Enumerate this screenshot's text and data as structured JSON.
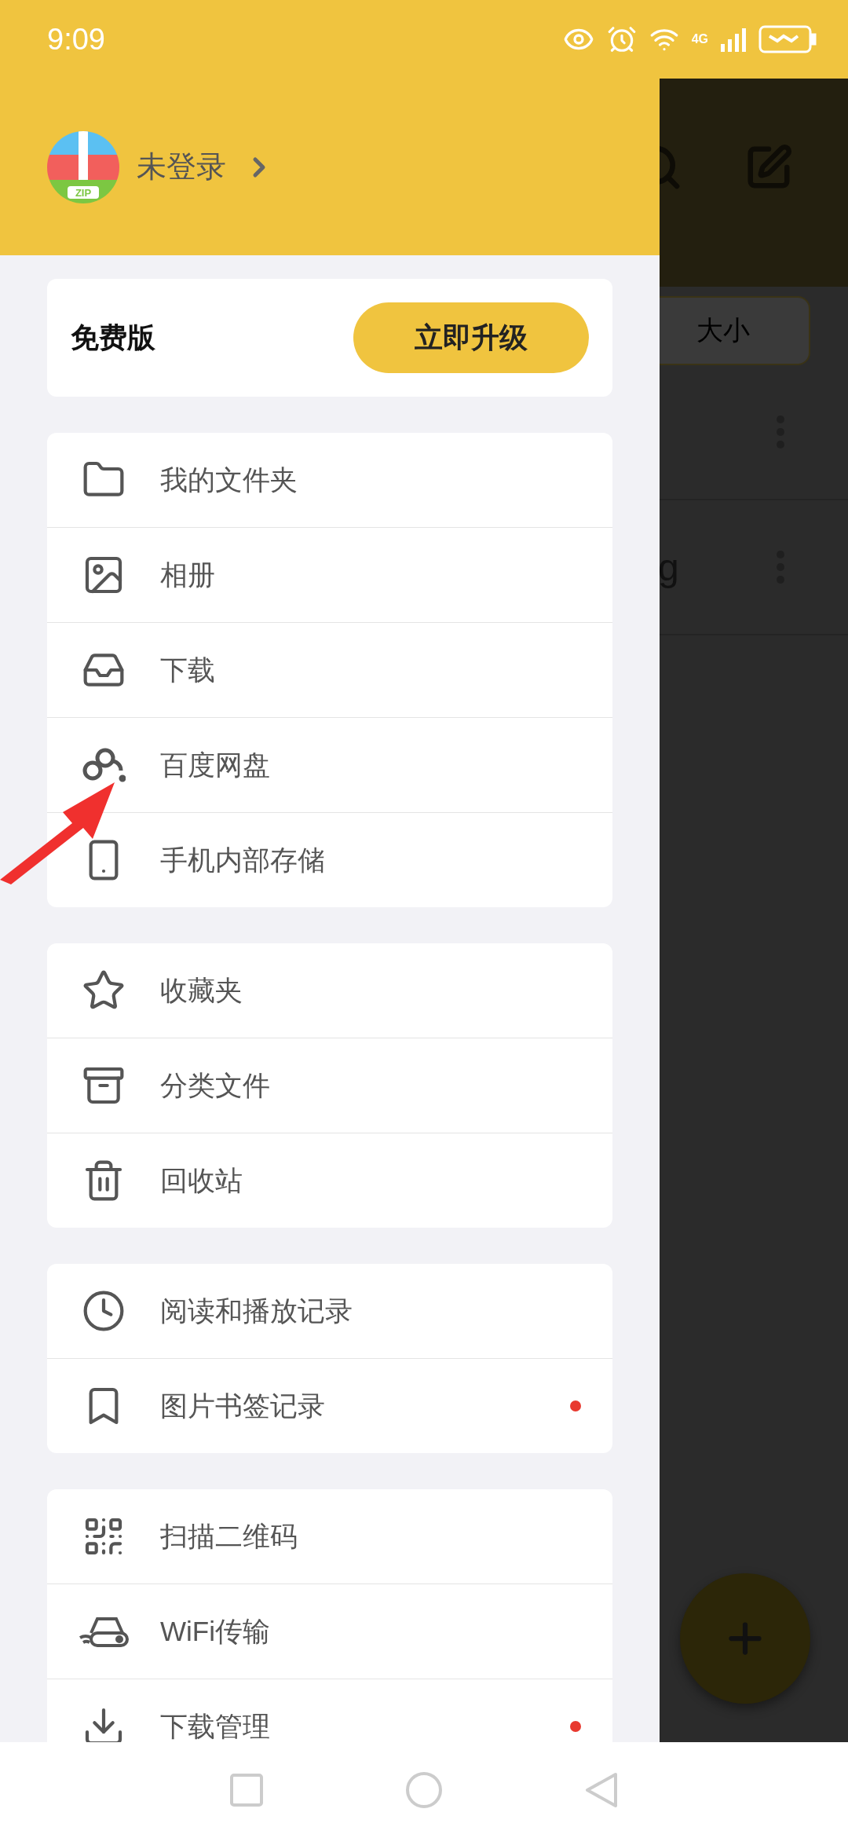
{
  "status_bar": {
    "time": "9:09",
    "network": "4G"
  },
  "profile": {
    "logo_text": "ZIP",
    "name": "未登录"
  },
  "plan": {
    "label": "免费版",
    "upgrade_button": "立即升级"
  },
  "menu_groups": [
    {
      "items": [
        {
          "label": "我的文件夹",
          "dot": false
        },
        {
          "label": "相册",
          "dot": false
        },
        {
          "label": "下载",
          "dot": false
        },
        {
          "label": "百度网盘",
          "dot": false
        },
        {
          "label": "手机内部存储",
          "dot": false
        }
      ]
    },
    {
      "items": [
        {
          "label": "收藏夹",
          "dot": false
        },
        {
          "label": "分类文件",
          "dot": false
        },
        {
          "label": "回收站",
          "dot": false
        }
      ]
    },
    {
      "items": [
        {
          "label": "阅读和播放记录",
          "dot": false
        },
        {
          "label": "图片书签记录",
          "dot": true
        }
      ]
    },
    {
      "items": [
        {
          "label": "扫描二维码",
          "dot": false
        },
        {
          "label": "WiFi传输",
          "dot": false
        },
        {
          "label": "下载管理",
          "dot": true
        }
      ]
    }
  ],
  "background_app": {
    "sort_chip": "大小",
    "row_text": "g"
  },
  "annotation": {
    "kind": "arrow"
  }
}
